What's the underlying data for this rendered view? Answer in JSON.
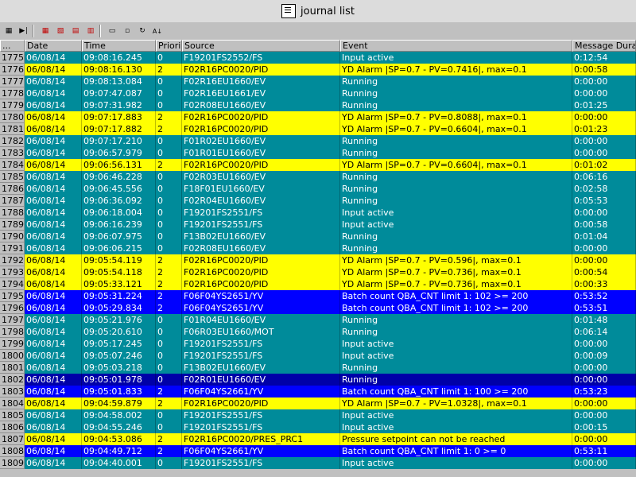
{
  "window": {
    "title": "journal list"
  },
  "toolbar": {
    "icons": [
      "column-config-icon",
      "first-page-icon",
      "filter-add-icon",
      "filter-remove-icon",
      "filter-edit-icon",
      "filter-clear-icon",
      "print-icon",
      "print-preview-icon",
      "refresh-icon",
      "sort-az-icon"
    ]
  },
  "columns": [
    "...",
    "Date",
    "Time",
    "Priori",
    "Source",
    "Event",
    "Message Durat"
  ],
  "colors": {
    "teal": "#008b9a",
    "yellow": "#ffff00",
    "blue": "#0000ff",
    "navy": "#0000a8"
  },
  "rows": [
    {
      "id": "1775",
      "date": "06/08/14",
      "time": "09:08:16.245",
      "priority": "0",
      "source": "F19201FS2552/FS",
      "event": "Input active",
      "duration": "0:12:54",
      "color": "teal"
    },
    {
      "id": "1776",
      "date": "06/08/14",
      "time": "09:08:16.130",
      "priority": "2",
      "source": "F02R16PC0020/PID",
      "event": "YD Alarm |SP=0.7 - PV=0.7416|, max=0.1",
      "duration": "0:00:58",
      "color": "yellow"
    },
    {
      "id": "1777",
      "date": "06/08/14",
      "time": "09:08:13.084",
      "priority": "0",
      "source": "F02R16EU1660/EV",
      "event": "Running",
      "duration": "0:00:00",
      "color": "teal"
    },
    {
      "id": "1778",
      "date": "06/08/14",
      "time": "09:07:47.087",
      "priority": "0",
      "source": "F02R16EU1661/EV",
      "event": "Running",
      "duration": "0:00:00",
      "color": "teal"
    },
    {
      "id": "1779",
      "date": "06/08/14",
      "time": "09:07:31.982",
      "priority": "0",
      "source": "F02R08EU1660/EV",
      "event": "Running",
      "duration": "0:01:25",
      "color": "teal"
    },
    {
      "id": "1780",
      "date": "06/08/14",
      "time": "09:07:17.883",
      "priority": "2",
      "source": "F02R16PC0020/PID",
      "event": "YD Alarm |SP=0.7 - PV=0.8088|, max=0.1",
      "duration": "0:00:00",
      "color": "yellow"
    },
    {
      "id": "1781",
      "date": "06/08/14",
      "time": "09:07:17.882",
      "priority": "2",
      "source": "F02R16PC0020/PID",
      "event": "YD Alarm |SP=0.7 - PV=0.6604|, max=0.1",
      "duration": "0:01:23",
      "color": "yellow"
    },
    {
      "id": "1782",
      "date": "06/08/14",
      "time": "09:07:17.210",
      "priority": "0",
      "source": "F01R02EU1660/EV",
      "event": "Running",
      "duration": "0:00:00",
      "color": "teal"
    },
    {
      "id": "1783",
      "date": "06/08/14",
      "time": "09:06:57.979",
      "priority": "0",
      "source": "F01R01EU1660/EV",
      "event": "Running",
      "duration": "0:00:00",
      "color": "teal"
    },
    {
      "id": "1784",
      "date": "06/08/14",
      "time": "09:06:56.131",
      "priority": "2",
      "source": "F02R16PC0020/PID",
      "event": "YD Alarm |SP=0.7 - PV=0.6604|, max=0.1",
      "duration": "0:01:02",
      "color": "yellow"
    },
    {
      "id": "1785",
      "date": "06/08/14",
      "time": "09:06:46.228",
      "priority": "0",
      "source": "F02R03EU1660/EV",
      "event": "Running",
      "duration": "0:06:16",
      "color": "teal"
    },
    {
      "id": "1786",
      "date": "06/08/14",
      "time": "09:06:45.556",
      "priority": "0",
      "source": "F18F01EU1660/EV",
      "event": "Running",
      "duration": "0:02:58",
      "color": "teal"
    },
    {
      "id": "1787",
      "date": "06/08/14",
      "time": "09:06:36.092",
      "priority": "0",
      "source": "F02R04EU1660/EV",
      "event": "Running",
      "duration": "0:05:53",
      "color": "teal"
    },
    {
      "id": "1788",
      "date": "06/08/14",
      "time": "09:06:18.004",
      "priority": "0",
      "source": "F19201FS2551/FS",
      "event": "Input active",
      "duration": "0:00:00",
      "color": "teal"
    },
    {
      "id": "1789",
      "date": "06/08/14",
      "time": "09:06:16.239",
      "priority": "0",
      "source": "F19201FS2551/FS",
      "event": "Input active",
      "duration": "0:00:58",
      "color": "teal"
    },
    {
      "id": "1790",
      "date": "06/08/14",
      "time": "09:06:07.975",
      "priority": "0",
      "source": "F13B02EU1660/EV",
      "event": "Running",
      "duration": "0:01:04",
      "color": "teal"
    },
    {
      "id": "1791",
      "date": "06/08/14",
      "time": "09:06:06.215",
      "priority": "0",
      "source": "F02R08EU1660/EV",
      "event": "Running",
      "duration": "0:00:00",
      "color": "teal"
    },
    {
      "id": "1792",
      "date": "06/08/14",
      "time": "09:05:54.119",
      "priority": "2",
      "source": "F02R16PC0020/PID",
      "event": "YD Alarm |SP=0.7 - PV=0.596|, max=0.1",
      "duration": "0:00:00",
      "color": "yellow"
    },
    {
      "id": "1793",
      "date": "06/08/14",
      "time": "09:05:54.118",
      "priority": "2",
      "source": "F02R16PC0020/PID",
      "event": "YD Alarm |SP=0.7 - PV=0.736|, max=0.1",
      "duration": "0:00:54",
      "color": "yellow"
    },
    {
      "id": "1794",
      "date": "06/08/14",
      "time": "09:05:33.121",
      "priority": "2",
      "source": "F02R16PC0020/PID",
      "event": "YD Alarm |SP=0.7 - PV=0.736|, max=0.1",
      "duration": "0:00:33",
      "color": "yellow"
    },
    {
      "id": "1795",
      "date": "06/08/14",
      "time": "09:05:31.224",
      "priority": "2",
      "source": "F06F04YS2651/YV",
      "event": "Batch count QBA_CNT limit 1: 102 >= 200",
      "duration": "0:53:52",
      "color": "blue"
    },
    {
      "id": "1796",
      "date": "06/08/14",
      "time": "09:05:29.834",
      "priority": "2",
      "source": "F06F04YS2651/YV",
      "event": "Batch count QBA_CNT limit 1: 102 >= 200",
      "duration": "0:53:51",
      "color": "blue"
    },
    {
      "id": "1797",
      "date": "06/08/14",
      "time": "09:05:21.976",
      "priority": "0",
      "source": "F01R04EU1660/EV",
      "event": "Running",
      "duration": "0:01:48",
      "color": "teal"
    },
    {
      "id": "1798",
      "date": "06/08/14",
      "time": "09:05:20.610",
      "priority": "0",
      "source": "F06R03EU1660/MOT",
      "event": "Running",
      "duration": "0:06:14",
      "color": "teal"
    },
    {
      "id": "1799",
      "date": "06/08/14",
      "time": "09:05:17.245",
      "priority": "0",
      "source": "F19201FS2551/FS",
      "event": "Input active",
      "duration": "0:00:00",
      "color": "teal"
    },
    {
      "id": "1800",
      "date": "06/08/14",
      "time": "09:05:07.246",
      "priority": "0",
      "source": "F19201FS2551/FS",
      "event": "Input active",
      "duration": "0:00:09",
      "color": "teal"
    },
    {
      "id": "1801",
      "date": "06/08/14",
      "time": "09:05:03.218",
      "priority": "0",
      "source": "F13B02EU1660/EV",
      "event": "Running",
      "duration": "0:00:00",
      "color": "teal"
    },
    {
      "id": "1802",
      "date": "06/08/14",
      "time": "09:05:01.978",
      "priority": "0",
      "source": "F02R01EU1660/EV",
      "event": "Running",
      "duration": "0:00:00",
      "color": "navy"
    },
    {
      "id": "1803",
      "date": "06/08/14",
      "time": "09:05:01.833",
      "priority": "2",
      "source": "F06F04YS2661/YV",
      "event": "Batch count QBA_CNT limit 1: 100 >= 200",
      "duration": "0:53:23",
      "color": "blue"
    },
    {
      "id": "1804",
      "date": "06/08/14",
      "time": "09:04:59.879",
      "priority": "2",
      "source": "F02R16PC0020/PID",
      "event": "YD Alarm |SP=0.7 - PV=1.0328|, max=0.1",
      "duration": "0:00:00",
      "color": "yellow"
    },
    {
      "id": "1805",
      "date": "06/08/14",
      "time": "09:04:58.002",
      "priority": "0",
      "source": "F19201FS2551/FS",
      "event": "Input active",
      "duration": "0:00:00",
      "color": "teal"
    },
    {
      "id": "1806",
      "date": "06/08/14",
      "time": "09:04:55.246",
      "priority": "0",
      "source": "F19201FS2551/FS",
      "event": "Input active",
      "duration": "0:00:15",
      "color": "teal"
    },
    {
      "id": "1807",
      "date": "06/08/14",
      "time": "09:04:53.086",
      "priority": "2",
      "source": "F02R16PC0020/PRES_PRC1",
      "event": "Pressure setpoint can not be reached",
      "duration": "0:00:00",
      "color": "yellow"
    },
    {
      "id": "1808",
      "date": "06/08/14",
      "time": "09:04:49.712",
      "priority": "2",
      "source": "F06F04YS2661/YV",
      "event": "Batch count QBA_CNT limit 1: 0 >= 0",
      "duration": "0:53:11",
      "color": "blue"
    },
    {
      "id": "1809",
      "date": "06/08/14",
      "time": "09:04:40.001",
      "priority": "0",
      "source": "F19201FS2551/FS",
      "event": "Input active",
      "duration": "0:00:00",
      "color": "teal"
    }
  ]
}
